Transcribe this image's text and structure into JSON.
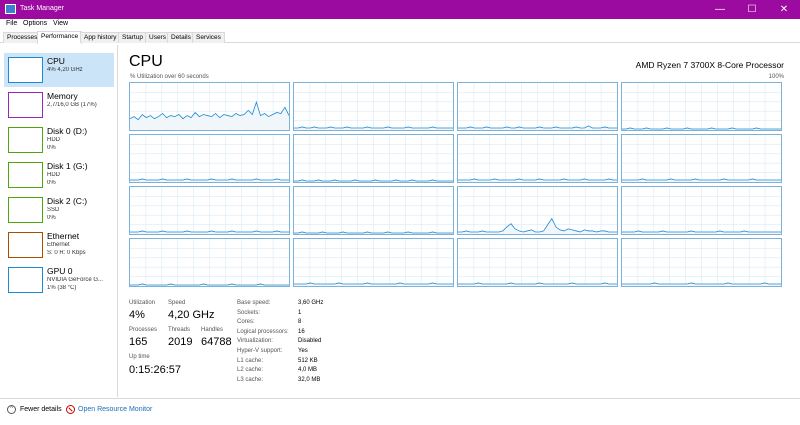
{
  "window": {
    "title": "Task Manager",
    "minimize": "—",
    "maximize": "☐",
    "close": "✕"
  },
  "menu": [
    "File",
    "Options",
    "View"
  ],
  "tabs": [
    "Processes",
    "Performance",
    "App history",
    "Startup",
    "Users",
    "Details",
    "Services"
  ],
  "active_tab": "Performance",
  "sidebar": {
    "items": [
      {
        "title": "CPU",
        "lines": [
          "4% 4,20 GHz"
        ],
        "color": "#1a8ad4"
      },
      {
        "title": "Memory",
        "lines": [
          "2,7/16,0 GB (17%)"
        ],
        "color": "#9528b4"
      },
      {
        "title": "Disk 0 (D:)",
        "lines": [
          "HDD",
          "0%"
        ],
        "color": "#4da60c"
      },
      {
        "title": "Disk 1 (G:)",
        "lines": [
          "HDD",
          "0%"
        ],
        "color": "#4da60c"
      },
      {
        "title": "Disk 2 (C:)",
        "lines": [
          "SSD",
          "0%"
        ],
        "color": "#4da60c"
      },
      {
        "title": "Ethernet",
        "lines": [
          "Ethernet",
          "S: 0 R: 0 Kbps"
        ],
        "color": "#a74f01"
      },
      {
        "title": "GPU 0",
        "lines": [
          "NVIDIA GeForce G...",
          "1% (38 °C)"
        ],
        "color": "#1a8ad4"
      }
    ]
  },
  "main": {
    "title": "CPU",
    "model": "AMD Ryzen 7 3700X 8-Core Processor",
    "graph_label": "% Utilization over 60 seconds",
    "graph_max": "100%",
    "graph_color": "#1a8ad4",
    "core_graphs": [
      [
        10,
        12,
        9,
        14,
        11,
        13,
        10,
        12,
        15,
        11,
        13,
        12,
        14,
        10,
        13,
        11,
        16,
        12,
        14,
        13,
        12,
        15,
        11,
        14,
        13,
        12,
        15,
        13,
        14,
        18,
        14,
        26,
        13,
        15,
        12,
        14,
        16,
        15,
        21,
        13
      ],
      [
        1,
        1,
        2,
        1,
        1,
        2,
        1,
        1,
        1,
        2,
        1,
        1,
        1,
        2,
        1,
        1,
        1,
        1,
        2,
        1,
        1,
        1,
        1,
        2,
        1,
        1,
        1,
        1,
        2,
        1,
        1,
        1,
        1,
        1,
        2,
        1,
        1,
        1,
        1,
        1
      ],
      [
        1,
        1,
        1,
        2,
        1,
        1,
        1,
        2,
        1,
        1,
        1,
        1,
        2,
        1,
        1,
        2,
        1,
        1,
        1,
        1,
        2,
        1,
        1,
        1,
        2,
        1,
        1,
        1,
        1,
        2,
        1,
        1,
        3,
        1,
        1,
        1,
        2,
        1,
        1,
        1
      ],
      [
        0,
        0,
        1,
        0,
        0,
        0,
        1,
        0,
        0,
        0,
        0,
        1,
        0,
        0,
        0,
        0,
        1,
        0,
        0,
        0,
        0,
        0,
        1,
        0,
        0,
        0,
        0,
        1,
        0,
        0,
        0,
        0,
        0,
        1,
        0,
        0,
        0,
        0,
        0,
        0
      ],
      [
        1,
        1,
        1,
        2,
        1,
        1,
        1,
        1,
        2,
        1,
        1,
        1,
        1,
        1,
        2,
        1,
        1,
        1,
        1,
        1,
        2,
        1,
        1,
        1,
        1,
        2,
        1,
        1,
        1,
        1,
        1,
        2,
        1,
        1,
        1,
        1,
        2,
        1,
        1,
        1
      ],
      [
        0,
        0,
        1,
        0,
        0,
        0,
        1,
        0,
        0,
        0,
        1,
        0,
        0,
        0,
        0,
        1,
        0,
        0,
        0,
        0,
        1,
        0,
        0,
        0,
        0,
        1,
        0,
        0,
        0,
        1,
        0,
        0,
        0,
        0,
        1,
        0,
        0,
        0,
        0,
        0
      ],
      [
        1,
        1,
        1,
        1,
        2,
        1,
        1,
        1,
        1,
        2,
        1,
        1,
        1,
        1,
        1,
        2,
        1,
        1,
        1,
        1,
        2,
        1,
        1,
        1,
        1,
        1,
        2,
        1,
        1,
        1,
        1,
        2,
        1,
        1,
        1,
        1,
        1,
        2,
        1,
        1
      ],
      [
        1,
        1,
        1,
        1,
        1,
        2,
        1,
        1,
        1,
        1,
        1,
        1,
        2,
        1,
        1,
        1,
        1,
        1,
        2,
        1,
        1,
        1,
        1,
        1,
        1,
        2,
        1,
        1,
        1,
        1,
        1,
        1,
        2,
        1,
        1,
        1,
        1,
        1,
        1,
        1
      ],
      [
        1,
        1,
        1,
        2,
        1,
        1,
        1,
        1,
        2,
        1,
        1,
        1,
        1,
        1,
        2,
        1,
        1,
        1,
        1,
        1,
        2,
        1,
        1,
        1,
        1,
        2,
        1,
        1,
        1,
        1,
        1,
        2,
        1,
        1,
        1,
        1,
        2,
        1,
        1,
        1
      ],
      [
        0,
        0,
        1,
        0,
        0,
        0,
        0,
        1,
        0,
        0,
        0,
        0,
        1,
        0,
        0,
        0,
        0,
        0,
        1,
        0,
        0,
        0,
        0,
        1,
        0,
        0,
        0,
        0,
        1,
        0,
        0,
        0,
        0,
        0,
        1,
        0,
        0,
        0,
        0,
        0
      ],
      [
        1,
        1,
        2,
        1,
        1,
        1,
        2,
        1,
        1,
        1,
        1,
        2,
        6,
        9,
        4,
        2,
        1,
        2,
        3,
        1,
        1,
        2,
        8,
        14,
        6,
        3,
        2,
        4,
        3,
        2,
        1,
        3,
        2,
        2,
        1,
        2,
        2,
        1,
        1,
        1
      ],
      [
        1,
        1,
        1,
        1,
        2,
        1,
        1,
        1,
        1,
        1,
        2,
        1,
        1,
        1,
        1,
        1,
        1,
        2,
        1,
        1,
        1,
        1,
        1,
        1,
        2,
        1,
        1,
        1,
        1,
        1,
        2,
        1,
        1,
        1,
        1,
        1,
        1,
        1,
        1,
        1
      ],
      [
        0,
        0,
        0,
        1,
        0,
        0,
        0,
        0,
        0,
        0,
        1,
        0,
        0,
        0,
        0,
        0,
        0,
        0,
        1,
        0,
        0,
        0,
        0,
        0,
        0,
        1,
        0,
        0,
        0,
        0,
        0,
        0,
        1,
        0,
        0,
        0,
        0,
        0,
        0,
        0
      ],
      [
        1,
        1,
        1,
        1,
        2,
        1,
        1,
        1,
        1,
        1,
        1,
        2,
        1,
        1,
        1,
        1,
        1,
        1,
        2,
        1,
        1,
        1,
        1,
        1,
        1,
        1,
        2,
        1,
        1,
        1,
        1,
        1,
        1,
        1,
        2,
        1,
        1,
        1,
        1,
        1
      ],
      [
        1,
        1,
        1,
        1,
        1,
        2,
        1,
        1,
        1,
        1,
        1,
        1,
        1,
        2,
        1,
        1,
        1,
        1,
        1,
        1,
        2,
        1,
        1,
        1,
        1,
        1,
        1,
        1,
        2,
        1,
        1,
        1,
        1,
        1,
        1,
        1,
        2,
        1,
        1,
        1
      ],
      [
        1,
        1,
        1,
        1,
        1,
        1,
        1,
        1,
        2,
        1,
        1,
        1,
        1,
        1,
        1,
        1,
        1,
        2,
        1,
        1,
        1,
        1,
        1,
        1,
        1,
        1,
        2,
        1,
        1,
        1,
        1,
        1,
        1,
        1,
        1,
        2,
        1,
        1,
        1,
        1
      ]
    ]
  },
  "stats": {
    "utilization_label": "Utilization",
    "utilization": "4%",
    "speed_label": "Speed",
    "speed": "4,20 GHz",
    "processes_label": "Processes",
    "processes": "165",
    "threads_label": "Threads",
    "threads": "2019",
    "handles_label": "Handles",
    "handles": "64788",
    "uptime_label": "Up time",
    "uptime": "0:15:26:57"
  },
  "specs": [
    {
      "k": "Base speed:",
      "v": "3,60 GHz"
    },
    {
      "k": "Sockets:",
      "v": "1"
    },
    {
      "k": "Cores:",
      "v": "8"
    },
    {
      "k": "Logical processors:",
      "v": "16"
    },
    {
      "k": "Virtualization:",
      "v": "Disabled"
    },
    {
      "k": "Hyper-V support:",
      "v": "Yes"
    },
    {
      "k": "L1 cache:",
      "v": "512 KB"
    },
    {
      "k": "L2 cache:",
      "v": "4,0 MB"
    },
    {
      "k": "L3 cache:",
      "v": "32,0 MB"
    }
  ],
  "footer": {
    "fewer_details": "Fewer details",
    "resource_monitor": "Open Resource Monitor"
  }
}
